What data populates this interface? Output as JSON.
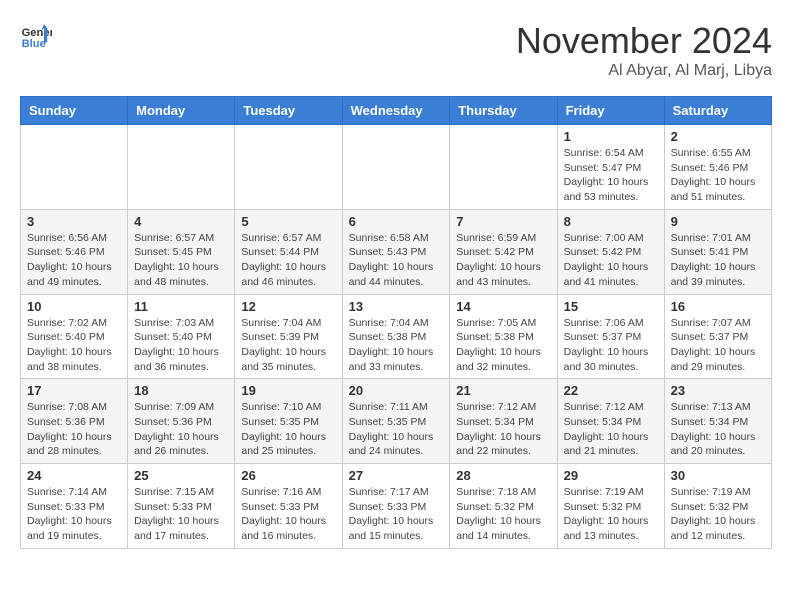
{
  "logo": {
    "line1": "General",
    "line2": "Blue"
  },
  "header": {
    "month": "November 2024",
    "location": "Al Abyar, Al Marj, Libya"
  },
  "weekdays": [
    "Sunday",
    "Monday",
    "Tuesday",
    "Wednesday",
    "Thursday",
    "Friday",
    "Saturday"
  ],
  "weeks": [
    [
      null,
      null,
      null,
      null,
      null,
      {
        "day": 1,
        "sunrise": "6:54 AM",
        "sunset": "5:47 PM",
        "daylight": "10 hours and 53 minutes."
      },
      {
        "day": 2,
        "sunrise": "6:55 AM",
        "sunset": "5:46 PM",
        "daylight": "10 hours and 51 minutes."
      }
    ],
    [
      {
        "day": 3,
        "sunrise": "6:56 AM",
        "sunset": "5:46 PM",
        "daylight": "10 hours and 49 minutes."
      },
      {
        "day": 4,
        "sunrise": "6:57 AM",
        "sunset": "5:45 PM",
        "daylight": "10 hours and 48 minutes."
      },
      {
        "day": 5,
        "sunrise": "6:57 AM",
        "sunset": "5:44 PM",
        "daylight": "10 hours and 46 minutes."
      },
      {
        "day": 6,
        "sunrise": "6:58 AM",
        "sunset": "5:43 PM",
        "daylight": "10 hours and 44 minutes."
      },
      {
        "day": 7,
        "sunrise": "6:59 AM",
        "sunset": "5:42 PM",
        "daylight": "10 hours and 43 minutes."
      },
      {
        "day": 8,
        "sunrise": "7:00 AM",
        "sunset": "5:42 PM",
        "daylight": "10 hours and 41 minutes."
      },
      {
        "day": 9,
        "sunrise": "7:01 AM",
        "sunset": "5:41 PM",
        "daylight": "10 hours and 39 minutes."
      }
    ],
    [
      {
        "day": 10,
        "sunrise": "7:02 AM",
        "sunset": "5:40 PM",
        "daylight": "10 hours and 38 minutes."
      },
      {
        "day": 11,
        "sunrise": "7:03 AM",
        "sunset": "5:40 PM",
        "daylight": "10 hours and 36 minutes."
      },
      {
        "day": 12,
        "sunrise": "7:04 AM",
        "sunset": "5:39 PM",
        "daylight": "10 hours and 35 minutes."
      },
      {
        "day": 13,
        "sunrise": "7:04 AM",
        "sunset": "5:38 PM",
        "daylight": "10 hours and 33 minutes."
      },
      {
        "day": 14,
        "sunrise": "7:05 AM",
        "sunset": "5:38 PM",
        "daylight": "10 hours and 32 minutes."
      },
      {
        "day": 15,
        "sunrise": "7:06 AM",
        "sunset": "5:37 PM",
        "daylight": "10 hours and 30 minutes."
      },
      {
        "day": 16,
        "sunrise": "7:07 AM",
        "sunset": "5:37 PM",
        "daylight": "10 hours and 29 minutes."
      }
    ],
    [
      {
        "day": 17,
        "sunrise": "7:08 AM",
        "sunset": "5:36 PM",
        "daylight": "10 hours and 28 minutes."
      },
      {
        "day": 18,
        "sunrise": "7:09 AM",
        "sunset": "5:36 PM",
        "daylight": "10 hours and 26 minutes."
      },
      {
        "day": 19,
        "sunrise": "7:10 AM",
        "sunset": "5:35 PM",
        "daylight": "10 hours and 25 minutes."
      },
      {
        "day": 20,
        "sunrise": "7:11 AM",
        "sunset": "5:35 PM",
        "daylight": "10 hours and 24 minutes."
      },
      {
        "day": 21,
        "sunrise": "7:12 AM",
        "sunset": "5:34 PM",
        "daylight": "10 hours and 22 minutes."
      },
      {
        "day": 22,
        "sunrise": "7:12 AM",
        "sunset": "5:34 PM",
        "daylight": "10 hours and 21 minutes."
      },
      {
        "day": 23,
        "sunrise": "7:13 AM",
        "sunset": "5:34 PM",
        "daylight": "10 hours and 20 minutes."
      }
    ],
    [
      {
        "day": 24,
        "sunrise": "7:14 AM",
        "sunset": "5:33 PM",
        "daylight": "10 hours and 19 minutes."
      },
      {
        "day": 25,
        "sunrise": "7:15 AM",
        "sunset": "5:33 PM",
        "daylight": "10 hours and 17 minutes."
      },
      {
        "day": 26,
        "sunrise": "7:16 AM",
        "sunset": "5:33 PM",
        "daylight": "10 hours and 16 minutes."
      },
      {
        "day": 27,
        "sunrise": "7:17 AM",
        "sunset": "5:33 PM",
        "daylight": "10 hours and 15 minutes."
      },
      {
        "day": 28,
        "sunrise": "7:18 AM",
        "sunset": "5:32 PM",
        "daylight": "10 hours and 14 minutes."
      },
      {
        "day": 29,
        "sunrise": "7:19 AM",
        "sunset": "5:32 PM",
        "daylight": "10 hours and 13 minutes."
      },
      {
        "day": 30,
        "sunrise": "7:19 AM",
        "sunset": "5:32 PM",
        "daylight": "10 hours and 12 minutes."
      }
    ]
  ]
}
